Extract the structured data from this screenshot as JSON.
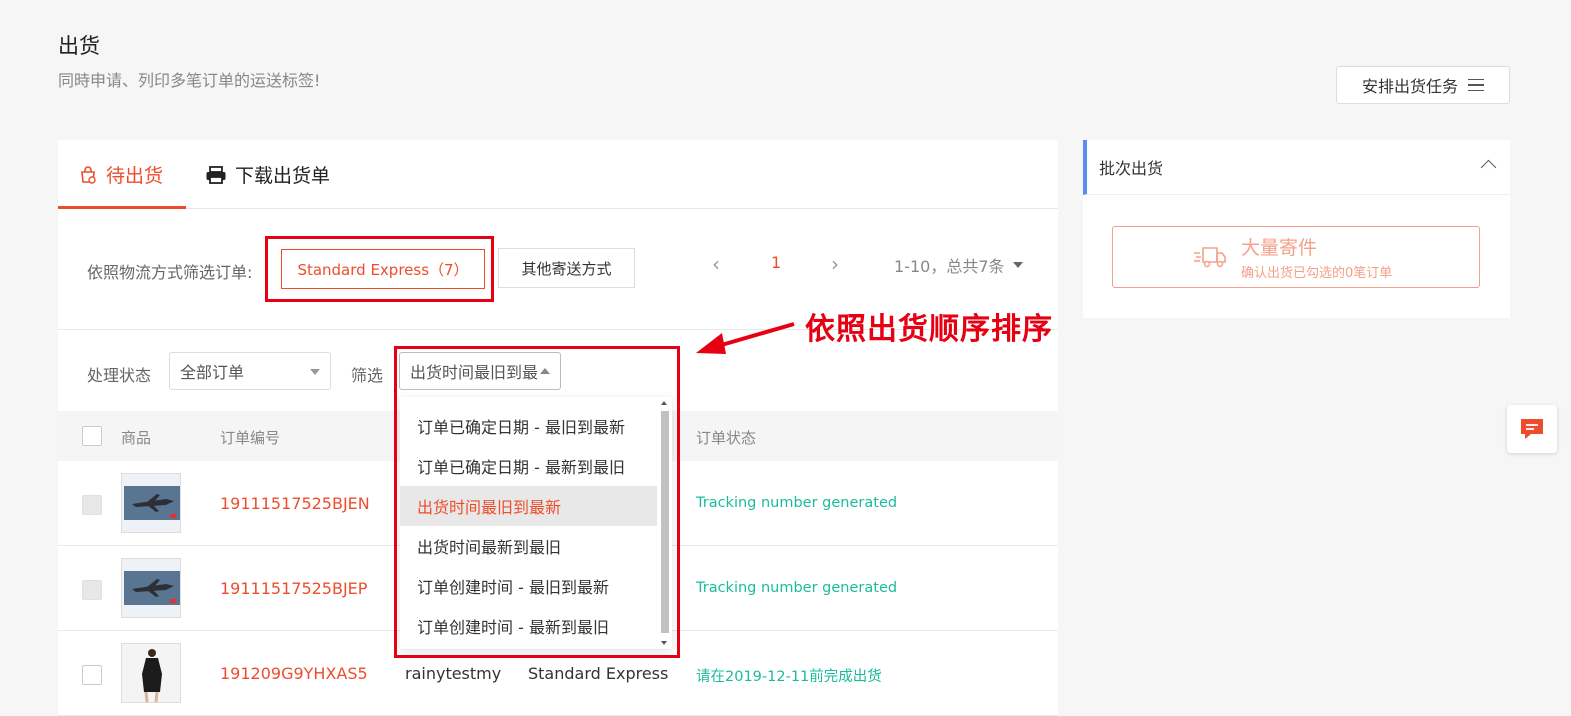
{
  "header": {
    "title": "出货",
    "subtitle": "同時申请、列印多笔订单的运送标签!",
    "arrange_button": "安排出货任务"
  },
  "tabs": [
    {
      "label": "待出货",
      "active": true,
      "icon": "shipping-bag-icon"
    },
    {
      "label": "下载出货单",
      "active": false,
      "icon": "printer-icon"
    }
  ],
  "logistics_filter": {
    "label": "依照物流方式筛选订单:",
    "standard_express": "Standard Express（7）",
    "other": "其他寄送方式"
  },
  "pagination": {
    "current": "1",
    "info": "1-10，总共7条"
  },
  "status_filter": {
    "label": "处理状态",
    "value": "全部订单"
  },
  "sort_filter": {
    "label": "筛选",
    "value": "出货时间最旧到最新"
  },
  "sort_options": [
    {
      "label": "订单已确定日期 - 最旧到最新",
      "active": false
    },
    {
      "label": "订单已确定日期 - 最新到最旧",
      "active": false
    },
    {
      "label": "出货时间最旧到最新",
      "active": true
    },
    {
      "label": "出货时间最新到最旧",
      "active": false
    },
    {
      "label": "订单创建时间 - 最旧到最新",
      "active": false
    },
    {
      "label": "订单创建时间 - 最新到最旧",
      "active": false
    }
  ],
  "table": {
    "headers": {
      "product": "商品",
      "order_no": "订单编号",
      "order_status": "订单状态"
    },
    "rows": [
      {
        "order_no": "19111517525BJEN",
        "buyer": "",
        "shipping": "",
        "status": "Tracking number generated",
        "thumb": "airplane"
      },
      {
        "order_no": "19111517525BJEP",
        "buyer": "",
        "shipping": "",
        "status": "Tracking number generated",
        "thumb": "airplane"
      },
      {
        "order_no": "191209G9YHXAS5",
        "buyer": "rainytestmy",
        "shipping": "Standard Express",
        "status": "请在2019-12-11前完成出货",
        "thumb": "dress"
      }
    ]
  },
  "side_panel": {
    "title": "批次出货",
    "bulk_title": "大量寄件",
    "bulk_sub": "确认出货已勾选的0笔订单"
  },
  "annotation": "依照出货顺序排序",
  "colors": {
    "accent": "#ee4d2d",
    "success": "#1abc9c",
    "annotation": "#e60012",
    "side_accent": "#5b8def"
  }
}
